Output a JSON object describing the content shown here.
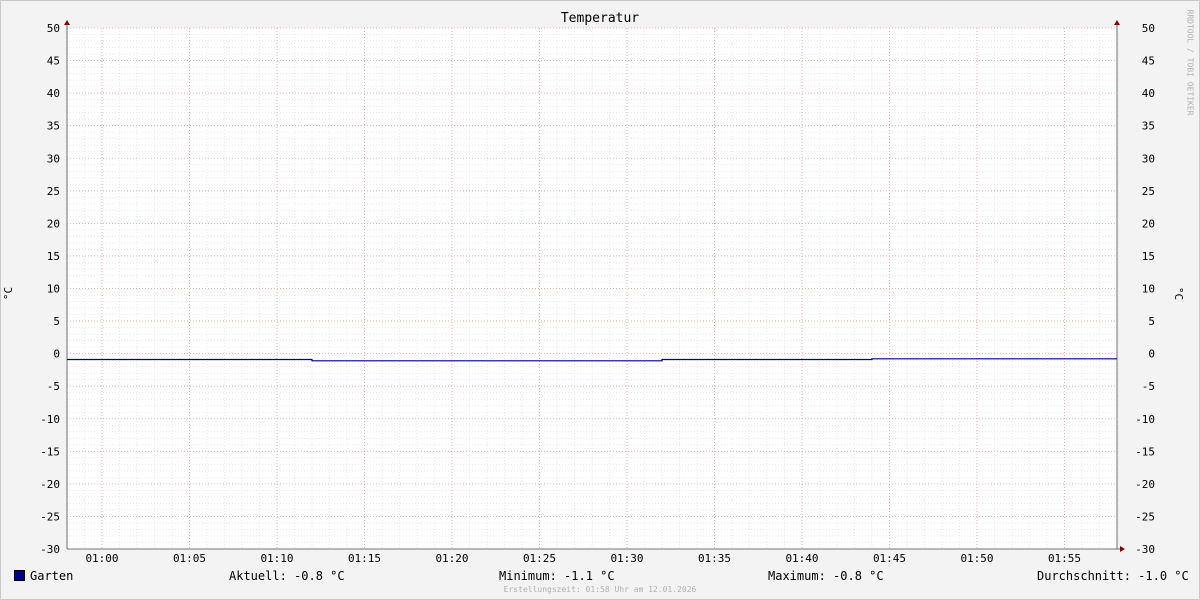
{
  "chart_data": {
    "type": "line",
    "title": "Temperatur",
    "ylabel": "°C",
    "ylabel_right": "°C",
    "ylim": [
      -30,
      50
    ],
    "y_ticks": [
      50,
      45,
      40,
      35,
      30,
      25,
      20,
      15,
      10,
      5,
      0,
      -5,
      -10,
      -15,
      -20,
      -25,
      -30
    ],
    "x_ticks": [
      "01:00",
      "01:05",
      "01:10",
      "01:15",
      "01:20",
      "01:25",
      "01:30",
      "01:35",
      "01:40",
      "01:45",
      "01:50",
      "01:55"
    ],
    "x_range_minutes": [
      58,
      118
    ],
    "grid": true,
    "series": [
      {
        "name": "Garten",
        "color": "#00008b",
        "x": [
          "00:58",
          "01:12",
          "01:12",
          "01:32",
          "01:32",
          "01:44",
          "01:44",
          "01:58"
        ],
        "values": [
          -0.9,
          -0.9,
          -1.1,
          -1.1,
          -0.9,
          -0.9,
          -0.8,
          -0.8
        ]
      }
    ]
  },
  "legend": {
    "series_name": "Garten",
    "current": "Aktuell: -0.8 °C",
    "minimum": "Minimum: -1.1 °C",
    "maximum": "Maximum: -0.8 °C",
    "average": "Durchschnitt: -1.0 °C"
  },
  "watermark": "RRDTOOL / TOBI OETIKER",
  "footer": "Erstellungszeit: 01:58 Uhr am 12.01.2026"
}
